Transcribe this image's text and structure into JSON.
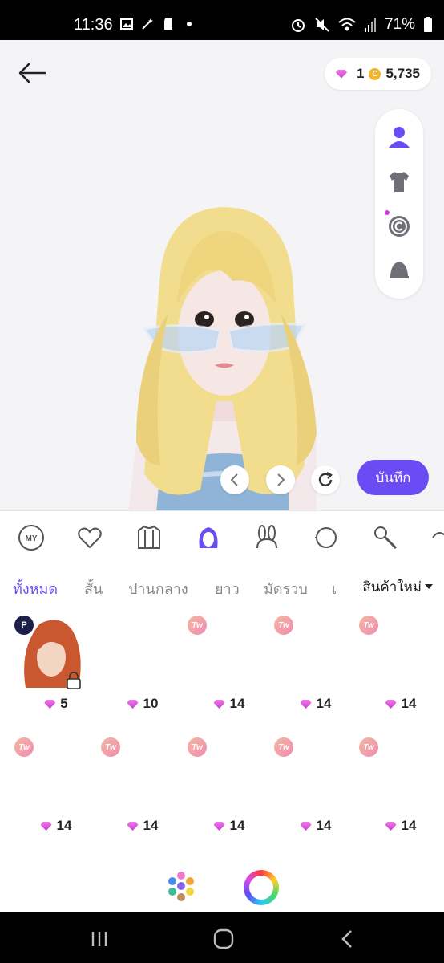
{
  "status_bar": {
    "time": "11:36",
    "battery": "71%",
    "left_icons": [
      "image-icon",
      "magic-wand-icon",
      "sd-card-icon",
      "dot-icon"
    ],
    "right_icons": [
      "alarm-icon",
      "mute-icon",
      "wifi-icon",
      "signal-icon",
      "battery-icon"
    ]
  },
  "header": {
    "gems": "1",
    "coins": "5,735"
  },
  "side_panel": {
    "items": [
      "avatar-icon",
      "shirt-icon",
      "copyright-icon",
      "bell-icon"
    ]
  },
  "actions": {
    "save_label": "บันทึก"
  },
  "categories": [
    "my-icon",
    "heart-icon",
    "jacket-icon",
    "hair-icon",
    "bunny-ears-icon",
    "face-icon",
    "microphone-icon",
    "accessory-icon"
  ],
  "sub_tabs": [
    "ทั้งหมด",
    "สั้น",
    "ปานกลาง",
    "ยาว",
    "มัดรวบ",
    "เ"
  ],
  "sort": {
    "label": "สินค้าใหม่"
  },
  "items_row1": [
    {
      "badge": "P",
      "price": "5",
      "locked": true
    },
    {
      "badge": "",
      "price": "10"
    },
    {
      "badge": "Tw",
      "price": "14"
    },
    {
      "badge": "Tw",
      "price": "14"
    },
    {
      "badge": "Tw",
      "price": "14"
    }
  ],
  "items_row2": [
    {
      "badge": "Tw",
      "price": "14"
    },
    {
      "badge": "Tw",
      "price": "14"
    },
    {
      "badge": "Tw",
      "price": "14"
    },
    {
      "badge": "Tw",
      "price": "14"
    },
    {
      "badge": "Tw",
      "price": "14"
    }
  ],
  "colors": {
    "accent": "#6a4cf5",
    "gem": "#d83cd8",
    "coin": "#f2b824"
  }
}
